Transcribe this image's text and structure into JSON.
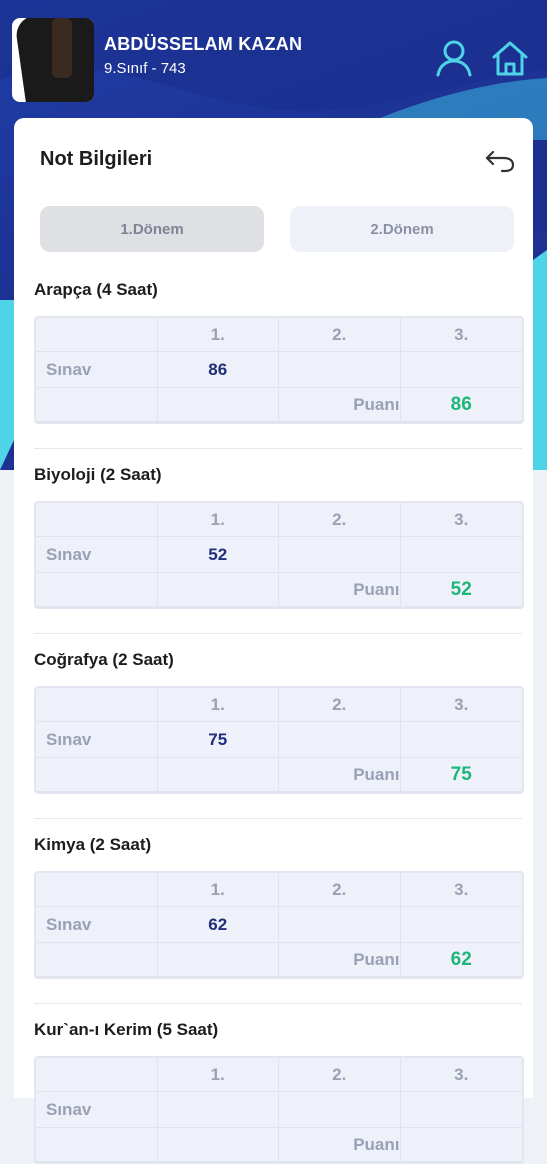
{
  "header": {
    "name": "ABDÜSSELAM KAZAN",
    "class_info": "9.Sınıf - 743",
    "profile_icon": "user-icon",
    "home_icon": "home-icon"
  },
  "card": {
    "title": "Not Bilgileri",
    "back_icon": "undo-arrow-icon"
  },
  "tabs": [
    {
      "label": "1.Dönem",
      "active": true
    },
    {
      "label": "2.Dönem",
      "active": false
    }
  ],
  "table_headers": [
    "1.",
    "2.",
    "3."
  ],
  "row_label": "Sınav",
  "score_label": "Puanı",
  "subjects": [
    {
      "title": "Arapça (4 Saat)",
      "exams": [
        "86",
        "",
        ""
      ],
      "score": "86"
    },
    {
      "title": "Biyoloji (2 Saat)",
      "exams": [
        "52",
        "",
        ""
      ],
      "score": "52"
    },
    {
      "title": "Coğrafya (2 Saat)",
      "exams": [
        "75",
        "",
        ""
      ],
      "score": "75"
    },
    {
      "title": "Kimya (2 Saat)",
      "exams": [
        "62",
        "",
        ""
      ],
      "score": "62"
    },
    {
      "title": "Kur`an-ı Kerim (5 Saat)",
      "exams": [
        "",
        "",
        ""
      ],
      "score": ""
    }
  ],
  "colors": {
    "header_blue": "#1f3ea8",
    "accent_cyan": "#4fd3e6",
    "score_green": "#1fb67a",
    "value_navy": "#1f2f7a"
  }
}
